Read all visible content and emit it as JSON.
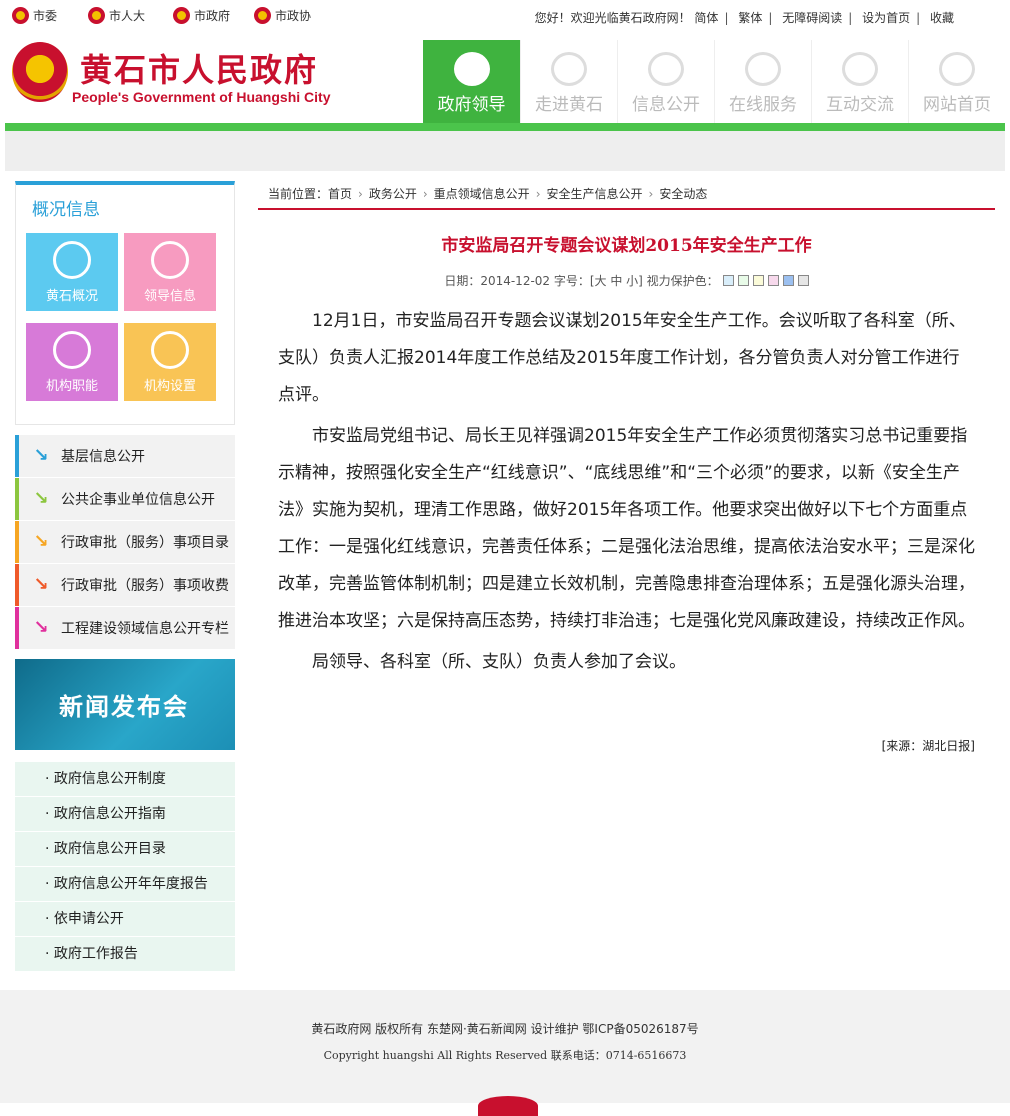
{
  "toplinks": [
    {
      "label": "市委"
    },
    {
      "label": "市人大"
    },
    {
      "label": "市政府"
    },
    {
      "label": "市政协"
    }
  ],
  "topright": {
    "welcome": "您好！欢迎光临黄石政府网！",
    "simplified": "简体",
    "traditional": "繁体",
    "accessible": "无障碍阅读",
    "homepage": "设为首页",
    "favorite": "收藏"
  },
  "header": {
    "title": "黄石市人民政府",
    "subtitle": "People's Government of Huangshi City"
  },
  "nav": [
    {
      "label": "政府领导"
    },
    {
      "label": "走进黄石"
    },
    {
      "label": "信息公开"
    },
    {
      "label": "在线服务"
    },
    {
      "label": "互动交流"
    },
    {
      "label": "网站首页"
    }
  ],
  "sidebar": {
    "overview_title": "概况信息",
    "tiles": [
      {
        "label": "黄石概况",
        "color": "#5ccaf0"
      },
      {
        "label": "领导信息",
        "color": "#f79bc0"
      },
      {
        "label": "机构职能",
        "color": "#d77ad8"
      },
      {
        "label": "机构设置",
        "color": "#f9c455"
      }
    ],
    "info_links": [
      {
        "label": "基层信息公开",
        "color": "#2aa0d8"
      },
      {
        "label": "公共企事业单位信息公开",
        "color": "#8cc63f"
      },
      {
        "label": "行政审批（服务）事项目录",
        "color": "#f6a623"
      },
      {
        "label": "行政审批（服务）事项收费",
        "color": "#ef5a2a"
      },
      {
        "label": "工程建设领域信息公开专栏",
        "color": "#e0309d"
      }
    ],
    "press_banner": "新闻发布会",
    "gov_links": [
      {
        "label": "· 政府信息公开制度"
      },
      {
        "label": "· 政府信息公开指南"
      },
      {
        "label": "· 政府信息公开目录"
      },
      {
        "label": "· 政府信息公开年年度报告"
      },
      {
        "label": "· 依申请公开"
      },
      {
        "label": "· 政府工作报告"
      }
    ]
  },
  "breadcrumb": {
    "prefix": "当前位置：",
    "items": [
      "首页",
      "政务公开",
      "重点领域信息公开",
      "安全生产信息公开",
      "安全动态"
    ]
  },
  "article": {
    "title": "市安监局召开专题会议谋划2015年安全生产工作",
    "meta": "日期：2014-12-02 字号：[大 中 小] 视力保护色：",
    "swatches": [
      "#d9eefa",
      "#e8fbe8",
      "#fbfbd9",
      "#f7d9ec",
      "#9cc0f0",
      "#e6e6e6"
    ],
    "paragraphs": [
      "12月1日，市安监局召开专题会议谋划2015年安全生产工作。会议听取了各科室（所、支队）负责人汇报2014年度工作总结及2015年度工作计划，各分管负责人对分管工作进行点评。",
      "市安监局党组书记、局长王见祥强调2015年安全生产工作必须贯彻落实习总书记重要指示精神，按照强化安全生产“红线意识”、“底线思维”和“三个必须”的要求，以新《安全生产法》实施为契机，理清工作思路，做好2015年各项工作。他要求突出做好以下七个方面重点工作：一是强化红线意识，完善责任体系；二是强化法治思维，提高依法治安水平；三是深化改革，完善监管体制机制；四是建立长效机制，完善隐患排查治理体系；五是强化源头治理，推进治本攻坚；六是保持高压态势，持续打非治违；七是强化党风廉政建设，持续改正作风。",
      "局领导、各科室（所、支队）负责人参加了会议。"
    ],
    "source": "[来源：湖北日报]"
  },
  "footer": {
    "line1": "黄石政府网 版权所有 东楚网·黄石新闻网 设计维护 鄂ICP备05026187号",
    "line2": "Copyright huangshi All Rights Reserved  联系电话：0714-6516673"
  }
}
